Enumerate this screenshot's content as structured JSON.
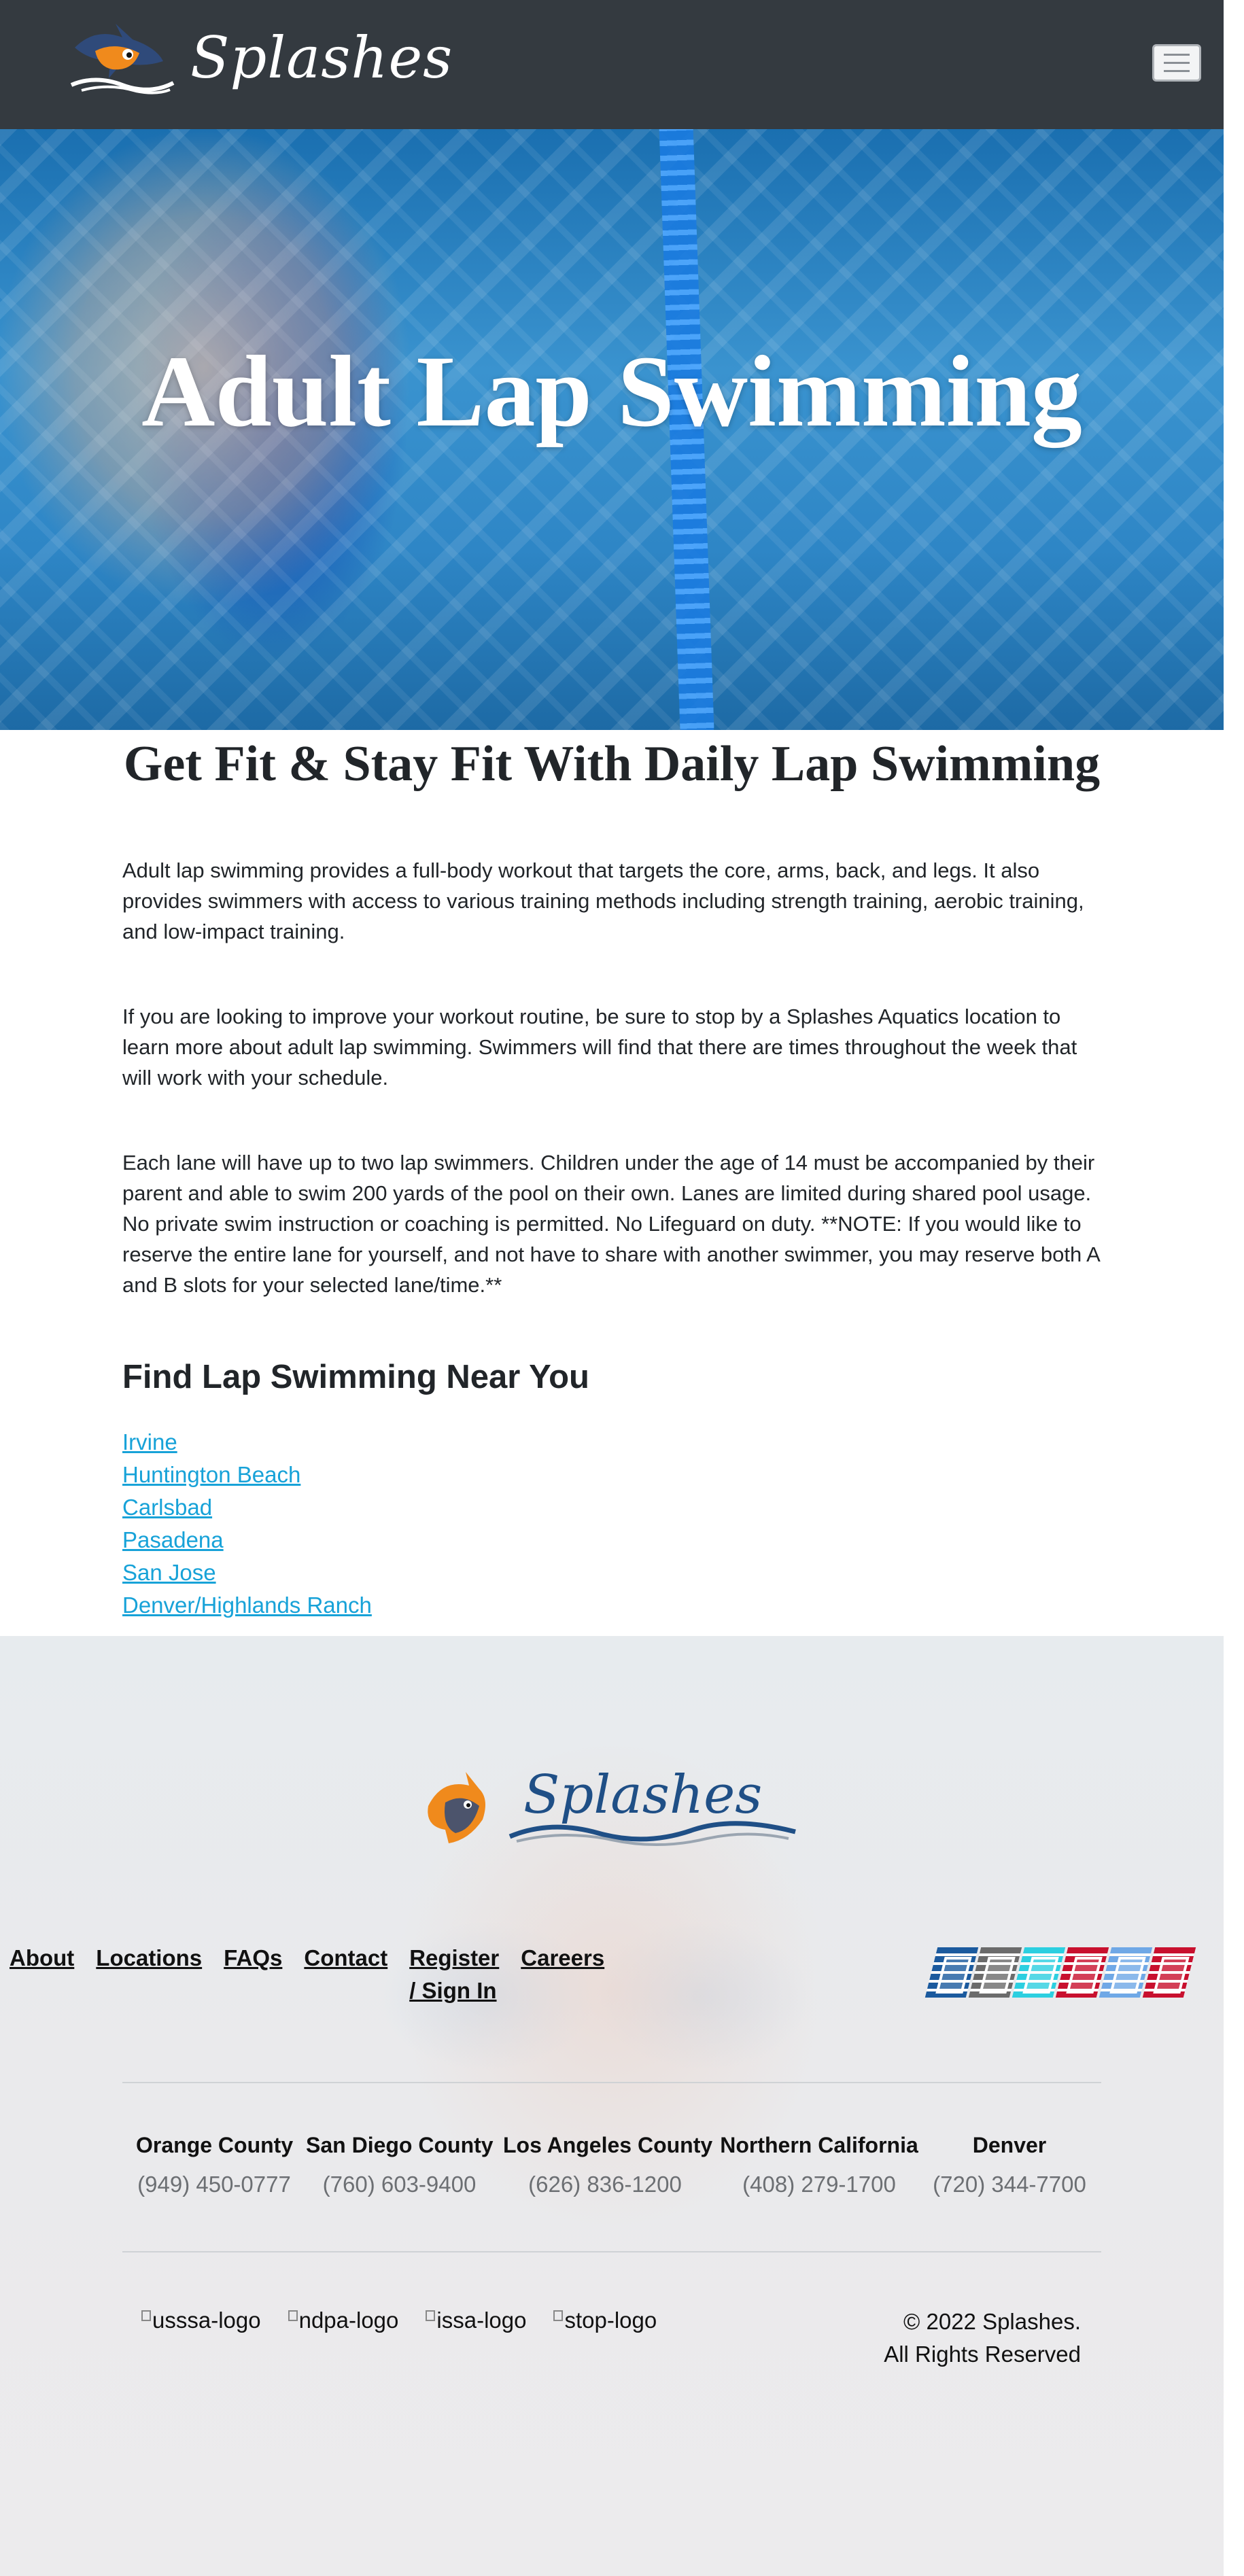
{
  "header": {
    "brand": "Splashes",
    "menu_icon": "hamburger-icon"
  },
  "hero": {
    "title": "Adult Lap Swimming"
  },
  "main": {
    "subtitle": "Get Fit & Stay Fit With Daily Lap Swimming",
    "paragraphs": [
      "Adult lap swimming provides a full-body workout that targets the core, arms, back, and legs. It also provides swimmers with access to various training methods including strength training, aerobic training, and low-impact training.",
      "If you are looking to improve your workout routine, be sure to stop by a Splashes Aquatics location to learn more about adult lap swimming. Swimmers will find that there are times throughout the week that will work with your schedule.",
      "Each lane will have up to two lap swimmers. Children under the age of 14 must be accompanied by their parent and able to swim 200 yards of the pool on their own. Lanes are limited during shared pool usage. No private swim instruction or coaching is permitted. No Lifeguard on duty. **NOTE: If you would like to reserve the entire lane for yourself, and not have to share with another swimmer, you may reserve both A and B slots for your selected lane/time.**"
    ],
    "find_heading": "Find Lap Swimming Near You",
    "locations": [
      "Irvine",
      "Huntington Beach",
      "Carlsbad",
      "Pasadena",
      "San Jose",
      "Denver/Highlands Ranch"
    ]
  },
  "footer": {
    "logo_text": "Splashes",
    "nav": [
      "About",
      "Locations",
      "FAQs",
      "Contact",
      "Register",
      "/ Sign In",
      "Careers"
    ],
    "social_colors": [
      "#1b5a9e",
      "#6b6b6b",
      "#2ccfe0",
      "#c8102e",
      "#6fa8e6",
      "#c8102e"
    ],
    "regions": [
      {
        "name": "Orange County",
        "phone": "(949) 450-0777"
      },
      {
        "name": "San Diego County",
        "phone": "(760) 603-9400"
      },
      {
        "name": "Los Angeles County",
        "phone": "(626) 836-1200"
      },
      {
        "name": "Northern California",
        "phone": "(408) 279-1700"
      },
      {
        "name": "Denver",
        "phone": "(720) 344-7700"
      }
    ],
    "badges": [
      "usssa-logo",
      "ndpa-logo",
      "issa-logo",
      "stop-logo"
    ],
    "copyright_line1": "© 2022 Splashes.",
    "copyright_line2": "All Rights Reserved"
  }
}
